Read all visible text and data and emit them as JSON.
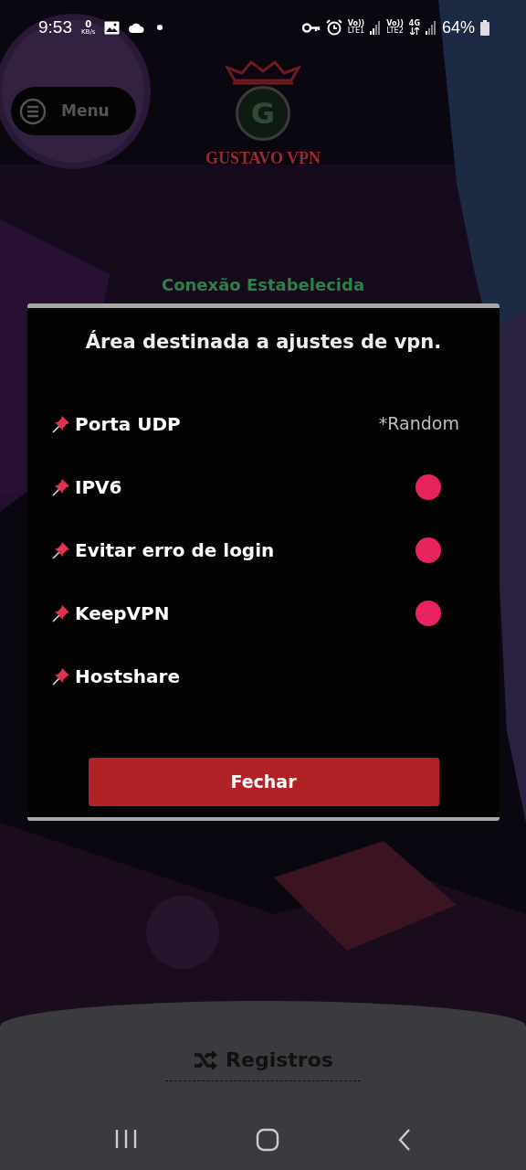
{
  "status_bar": {
    "time": "9:53",
    "net_speed_value": "0",
    "net_speed_unit": "KB/s",
    "sim1_volte": "Vo))",
    "sim1_label": "LTE1",
    "sim2_volte": "Vo))",
    "sim2_label": "LTE2",
    "network_type": "4G",
    "battery": "64%"
  },
  "header": {
    "menu_label": "Menu",
    "logo_letter": "G",
    "app_name": "GUSTAVO VPN"
  },
  "connection_status": "Conexão Estabelecida",
  "dialog": {
    "title": "Área destinada a ajustes de vpn.",
    "settings": [
      {
        "kind": "value",
        "label": "Porta UDP",
        "value": "*Random"
      },
      {
        "kind": "switch",
        "label": "IPV6",
        "on": true
      },
      {
        "kind": "switch",
        "label": "Evitar erro de login",
        "on": true
      },
      {
        "kind": "switch",
        "label": "KeepVPN",
        "on": true
      },
      {
        "kind": "plain",
        "label": "Hostshare"
      }
    ],
    "close_button": "Fechar"
  },
  "bottom_sheet": {
    "logs_label": "Registros"
  }
}
